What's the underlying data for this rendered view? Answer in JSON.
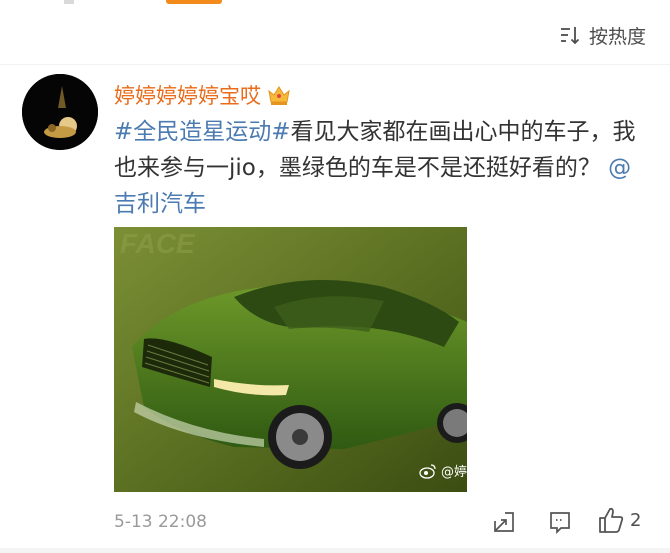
{
  "sort": {
    "label": "按热度"
  },
  "post": {
    "username": "婷婷婷婷婷宝哎",
    "text_parts": {
      "hashtag": "#全民造星运动#",
      "text": "看见大家都在画出心中的车子，我也来参与一jio，墨绿色的车是不是还挺好看的？",
      "mention": "@吉利汽车"
    },
    "image": {
      "type": "green car sketch",
      "watermark": "@婷"
    },
    "timestamp": "5-13 22:08",
    "like_count": "2"
  },
  "colors": {
    "username": "#e86c1b",
    "link": "#4b7bb1",
    "meta": "#9a9a9a"
  },
  "icons": [
    "sort-icon",
    "crown-icon",
    "weibo-icon",
    "share-icon",
    "comment-icon",
    "like-icon"
  ]
}
